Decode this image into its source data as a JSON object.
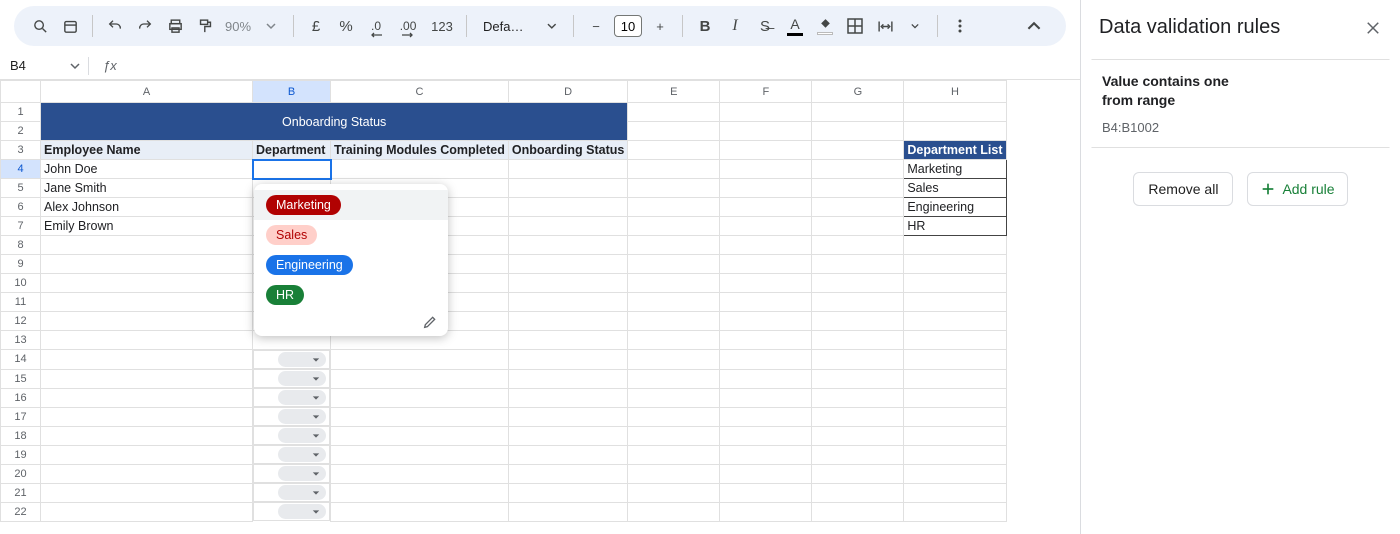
{
  "toolbar": {
    "zoom": "90%",
    "currency_symbol": "£",
    "percent": "%",
    "dec_dec": ".0",
    "dec_inc": ".00",
    "num_format": "123",
    "font": "Defaul...",
    "font_size": "10"
  },
  "namebox": {
    "ref": "B4"
  },
  "cols": {
    "A": "A",
    "B": "B",
    "C": "C",
    "D": "D",
    "E": "E",
    "F": "F",
    "G": "G",
    "H": "H"
  },
  "rows": {
    "r1": "1",
    "r2": "2",
    "r3": "3",
    "r4": "4",
    "r5": "5",
    "r6": "6",
    "r7": "7",
    "r8": "8",
    "r9": "9",
    "r10": "10",
    "r11": "11",
    "r12": "12",
    "r13": "13",
    "r14": "14",
    "r15": "15",
    "r16": "16",
    "r17": "17",
    "r18": "18",
    "r19": "19",
    "r20": "20",
    "r21": "21",
    "r22": "22"
  },
  "sheet": {
    "title": "Onboarding Status",
    "headers": {
      "a": "Employee Name",
      "b": "Department",
      "c": "Training Modules Completed",
      "d": "Onboarding Status"
    },
    "employees": {
      "e0": "John Doe",
      "e1": "Jane Smith",
      "e2": "Alex Johnson",
      "e3": "Emily Brown"
    },
    "deptlist_header": "Department List",
    "deptlist": {
      "d0": "Marketing",
      "d1": "Sales",
      "d2": "Engineering",
      "d3": "HR"
    }
  },
  "dropdown": {
    "opt0": "Marketing",
    "opt1": "Sales",
    "opt2": "Engineering",
    "opt3": "HR"
  },
  "pane": {
    "title": "Data validation rules",
    "rule_title_l1": "Value contains one",
    "rule_title_l2": "from range",
    "rule_range": "B4:B1002",
    "remove_all": "Remove all",
    "add_rule": "Add rule"
  }
}
